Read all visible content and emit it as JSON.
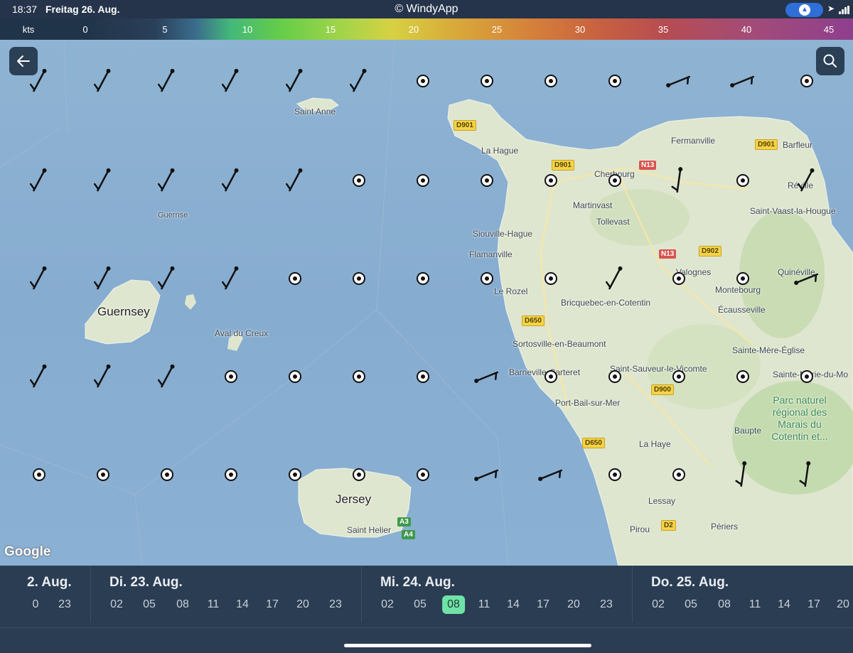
{
  "status_bar": {
    "time": "18:37",
    "date": "Freitag 26. Aug.",
    "app_title": "© WindyApp"
  },
  "legend": {
    "unit": "kts",
    "ticks": [
      "0",
      "5",
      "10",
      "15",
      "20",
      "25",
      "30",
      "35",
      "40",
      "45"
    ]
  },
  "map": {
    "places": {
      "saint_anne": "Saint Anne",
      "guernse": "Guernse",
      "guernsey": "Guernsey",
      "aval": "Aval du Creux",
      "jersey": "Jersey",
      "saint_helier": "Saint Helier",
      "la_hague": "La Hague",
      "cherbourg": "Cherbourg",
      "fermanville": "Fermanville",
      "barfleur": "Barfleur",
      "reville": "Réville",
      "saint_vaast": "Saint-Vaast-la-Hougue",
      "martinvast": "Martinvast",
      "tollevast": "Tollevast",
      "siouville": "Siouville-Hague",
      "flamanville": "Flamanville",
      "valognes": "Valognes",
      "quineville": "Quinéville",
      "montebourg": "Montebourg",
      "le_rozel": "Le Rozel",
      "bricquebec": "Bricquebec-en-Cotentin",
      "ecausseville": "Écausseville",
      "sortosville": "Sortosville-en-Beaumont",
      "sainte_mere": "Sainte-Mère-Église",
      "barneville": "Barneville-Carteret",
      "saint_sauveur": "Saint-Sauveur-le-Vicomte",
      "sainte_marie": "Sainte-Marie-du-Mo",
      "port_bail": "Port-Bail-sur-Mer",
      "baupte": "Baupte",
      "la_haye": "La Haye",
      "lessay": "Lessay",
      "pirou": "Pirou",
      "periers": "Périers",
      "park": "Parc naturel régional des Marais du Cotentin et..."
    },
    "shields": {
      "d901a": "D901",
      "d901b": "D901",
      "d901c": "D901",
      "n13a": "N13",
      "n13b": "N13",
      "d902": "D902",
      "d650a": "D650",
      "d650b": "D650",
      "d900": "D900",
      "d2": "D2",
      "a3": "A3",
      "a4": "A4"
    },
    "attribution": "Google",
    "back_icon": "arrow-left-icon",
    "search_icon": "search-icon"
  },
  "timeline": {
    "days": [
      {
        "label": "2. Aug.",
        "hours": [
          "0",
          "23"
        ]
      },
      {
        "label": "Di. 23. Aug.",
        "hours": [
          "02",
          "05",
          "08",
          "11",
          "14",
          "17",
          "20",
          "23"
        ]
      },
      {
        "label": "Mi. 24. Aug.",
        "hours": [
          "02",
          "05",
          "08",
          "11",
          "14",
          "17",
          "20",
          "23"
        ],
        "selected_hour": "08"
      },
      {
        "label": "Do. 25. Aug.",
        "hours": [
          "02",
          "05",
          "08",
          "11",
          "14",
          "17",
          "20"
        ]
      }
    ]
  },
  "colors": {
    "status_bg": "#25344a",
    "timeline_bg": "#2b3d52",
    "selected_hour": "#6fe3a7",
    "water": "#8fb3d2",
    "land": "#dfe6cf"
  }
}
